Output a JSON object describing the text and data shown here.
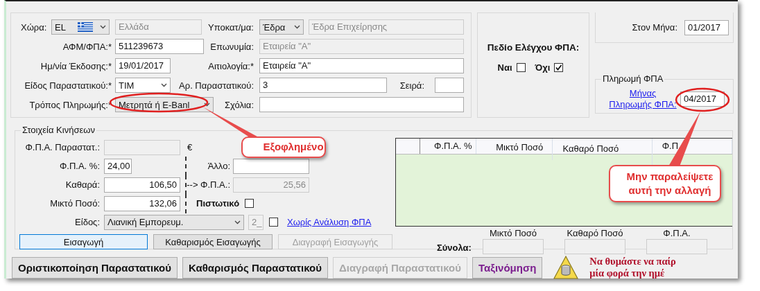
{
  "header": {
    "country": {
      "label": "Χώρα:",
      "code": "EL",
      "name": "Ελλάδα"
    },
    "branch": {
      "label": "Υποκατ/μα:",
      "value": "Έδρα",
      "name": "Έδρα Επιχείρησης"
    },
    "vat_number": {
      "label": "ΑΦΜ/ΦΠΑ:*",
      "value": "511239673"
    },
    "company": {
      "label": "Επωνυμία:",
      "value": "Εταιρεία \"Α\""
    },
    "issue_date": {
      "label": "Ημ/νία Έκδοσης:*",
      "value": "19/01/2017"
    },
    "reason": {
      "label": "Αιτιολογία:*",
      "value": "Εταιρεία \"Α\""
    },
    "doc_type": {
      "label": "Είδος Παραστατικού:*",
      "value": "ΤΙΜ"
    },
    "doc_number": {
      "label": "Αρ. Παραστατικού:",
      "value": "3"
    },
    "series": {
      "label": "Σειρά:"
    },
    "payment_method": {
      "label": "Τρόπος Πληρωμής:*",
      "value": "Μετρητά ή E-Banl"
    },
    "comments": {
      "label": "Σχόλια:"
    }
  },
  "vat_check": {
    "title": "Πεδίο Ελέγχου ΦΠΑ:",
    "options": [
      {
        "label": "Ναι",
        "checked": false
      },
      {
        "label": "Όχι",
        "checked": true
      }
    ]
  },
  "posting": {
    "label": "Στον Μήνα:",
    "value": "01/2017"
  },
  "vat_payment": {
    "title": "Πληρωμή ΦΠΑ",
    "link": "Μήνας Πληρωμής ΦΠΑ:",
    "value": "04/2017"
  },
  "movements": {
    "title": "Στοιχεία Κινήσεων",
    "doc_vat": {
      "label": "Φ.Π.Α. Παραστατ.:",
      "currency": "€"
    },
    "vat_rate": {
      "label": "Φ.Π.Α. %:",
      "value": "24,00"
    },
    "other": {
      "label": "Άλλο:"
    },
    "net": {
      "label": "Καθαρά:",
      "value": "106,50"
    },
    "vat": {
      "label": "--> Φ.Π.Α.:",
      "value": "25,56"
    },
    "gross": {
      "label": "Μικτό Ποσό:",
      "value": "132,06"
    },
    "credit": {
      "label": "Πιστωτικό",
      "checked": false
    },
    "category": {
      "label": "Είδος:",
      "value": "Λιανική Εμπορευμ.",
      "code": "2_"
    },
    "no_vat_analysis": {
      "label": "Χωρίς Ανάλυση ΦΠΑ",
      "checked": false
    },
    "buttons": [
      {
        "label": "Εισαγωγή",
        "selected": true,
        "disabled": false
      },
      {
        "label": "Καθαρισμός Εισαγωγής",
        "selected": false,
        "disabled": false
      },
      {
        "label": "Διαγραφή Εισαγωγής",
        "selected": false,
        "disabled": true
      }
    ]
  },
  "vat_table": {
    "columns": [
      "Φ.Π.Α. %",
      "Μικτό Ποσό",
      "Καθαρό Ποσό",
      "Φ.Π."
    ]
  },
  "totals": {
    "label": "Σύνολα:",
    "columns": [
      "Μικτό Ποσό",
      "Καθαρό Ποσό",
      "Φ.Π.Α."
    ]
  },
  "actions": [
    {
      "label": "Οριστικοποίηση Παραστατικού",
      "kind": "normal",
      "disabled": false
    },
    {
      "label": "Καθαρισμός Παραστατικού",
      "kind": "normal",
      "disabled": false
    },
    {
      "label": "Διαγραφή Παραστατικού",
      "kind": "normal",
      "disabled": true
    },
    {
      "label": "Ταξινόμηση",
      "kind": "accent",
      "disabled": false
    }
  ],
  "reminder": {
    "lines": [
      "Να θυμάστε να παίρ",
      "μία φορά την ημέ"
    ]
  },
  "callouts": [
    {
      "text": "Εξοφλημένο"
    },
    {
      "text": "Μην παραλείψετε αυτή την αλλαγή"
    }
  ]
}
